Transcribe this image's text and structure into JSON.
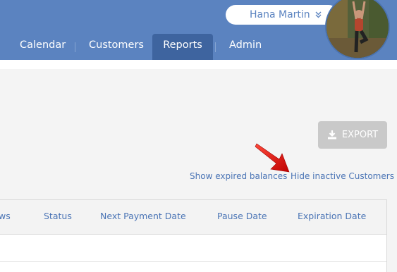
{
  "user": {
    "name": "Hana Martin"
  },
  "nav": {
    "items": [
      {
        "label": "Calendar",
        "active": false
      },
      {
        "label": "Customers",
        "active": false
      },
      {
        "label": "Reports",
        "active": true
      },
      {
        "label": "Admin",
        "active": false
      }
    ]
  },
  "toolbar": {
    "export_label": "EXPORT",
    "export_icon": "download-icon"
  },
  "links": {
    "show_expired": "Show expired balances",
    "hide_inactive": "Hide inactive Customers"
  },
  "table": {
    "columns": [
      "ws",
      "Status",
      "Next Payment Date",
      "Pause Date",
      "Expiration Date"
    ]
  },
  "colors": {
    "header_bg": "#5b83c0",
    "active_tab_bg": "#3e649f",
    "link": "#4a74b5",
    "export_disabled": "#c9c9c9",
    "arrow": "#e60000"
  }
}
